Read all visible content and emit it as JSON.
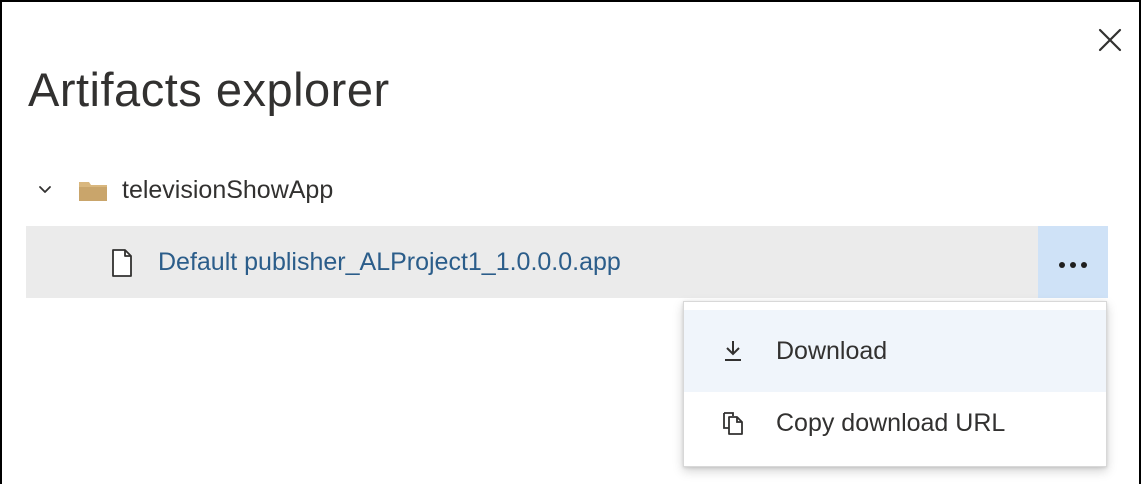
{
  "dialog": {
    "title": "Artifacts explorer",
    "close_icon": "close-icon"
  },
  "tree": {
    "folder": {
      "label": "televisionShowApp",
      "expanded": true,
      "icon": "folder-icon",
      "chevron_icon": "chevron-down-icon"
    },
    "file": {
      "label": "Default publisher_ALProject1_1.0.0.0.app",
      "icon": "file-icon",
      "more_icon": "more-horizontal-icon"
    }
  },
  "context_menu": {
    "items": [
      {
        "label": "Download",
        "icon": "download-icon"
      },
      {
        "label": "Copy download URL",
        "icon": "copy-icon"
      }
    ]
  },
  "colors": {
    "file_link": "#2b5d8a",
    "row_background": "#ebebeb",
    "more_button_background": "#cfe2f7",
    "menu_highlight": "#f0f5fb",
    "folder": "#d9b77e"
  }
}
